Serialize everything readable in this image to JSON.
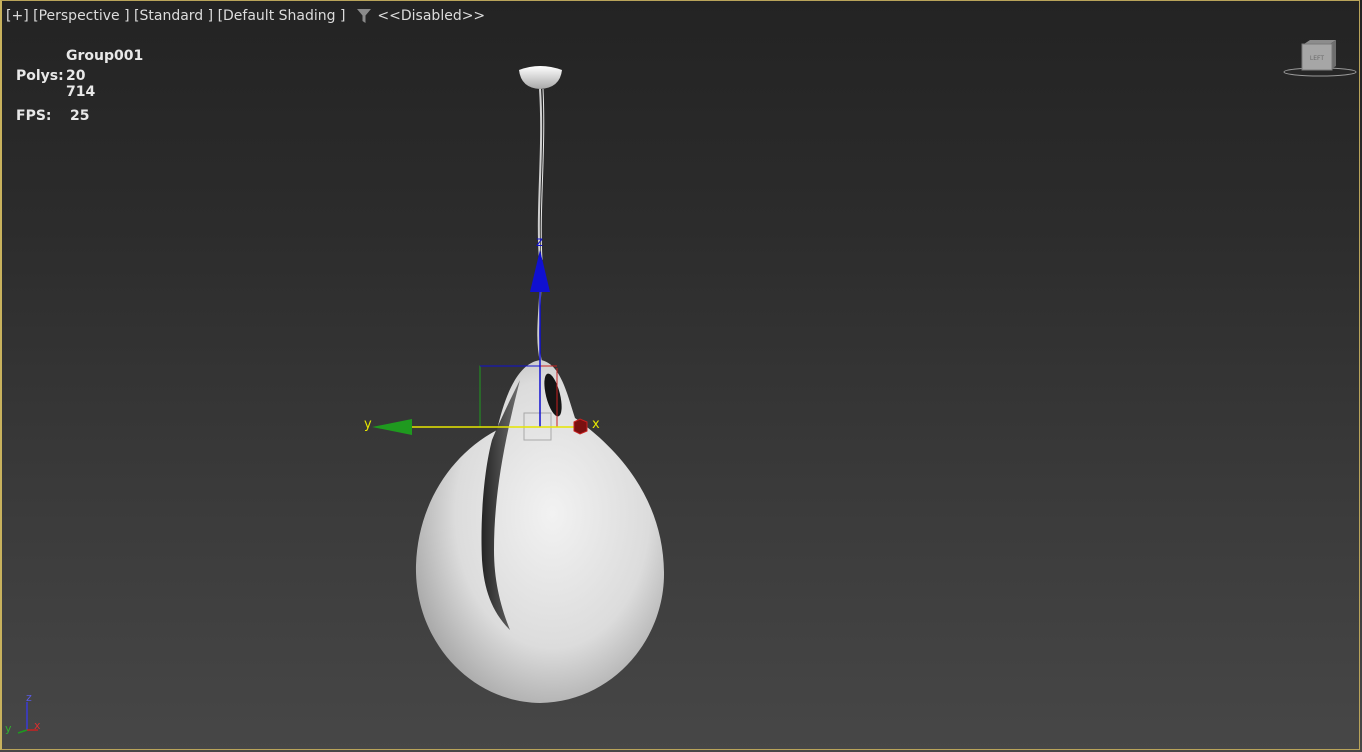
{
  "viewport": {
    "label_plus": "[+]",
    "label_view": "[Perspective ]",
    "label_renderer": "[Standard ]",
    "label_shading": "[Default Shading ]",
    "filter_status": "<<Disabled>>"
  },
  "stats": {
    "object_name": "Group001",
    "polys_label": "Polys:",
    "polys_value": "20 714",
    "fps_label": "FPS:",
    "fps_value": "25"
  },
  "viewcube": {
    "face_label": "LEFT"
  },
  "gizmo": {
    "x_label": "x",
    "y_label": "y",
    "z_label": "z"
  },
  "tripod": {
    "z_label": "z",
    "y_label": "y",
    "x_label": "x"
  },
  "colors": {
    "frame": "#c8b25d",
    "axis_x": "#c82020",
    "axis_y": "#1f9a1f",
    "axis_z": "#1010d0",
    "gizmo_active": "#e6e600"
  }
}
